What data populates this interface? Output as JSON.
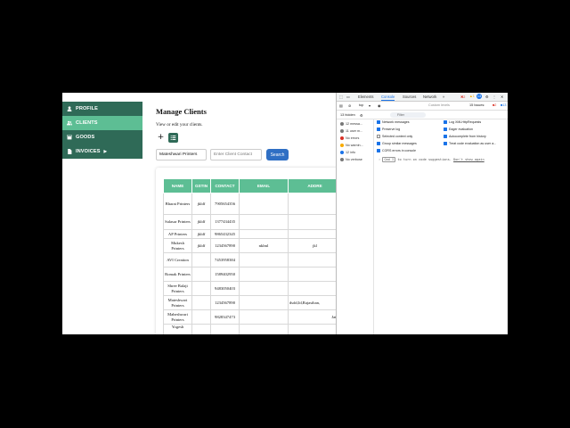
{
  "sidebar": {
    "items": [
      {
        "label": "PROFILE",
        "icon": "user-icon"
      },
      {
        "label": "CLIENTS",
        "icon": "users-icon",
        "active": true
      },
      {
        "label": "GOODS",
        "icon": "box-icon"
      },
      {
        "label": "INVOICES",
        "icon": "file-icon",
        "caret": "▶"
      }
    ]
  },
  "main": {
    "title": "Manage Clients",
    "subtitle": "View or edit your clients.",
    "add_label": "+",
    "search": {
      "client_name_value": "Mateshwari Printers",
      "contact_placeholder": "Enter Client Contact",
      "button_label": "Search"
    },
    "table": {
      "headers": [
        "NAME",
        "GSTIN",
        "CONTACT",
        "EMAIL",
        "ADDRE"
      ],
      "rows": [
        {
          "name": "Bharat Printers",
          "gstin": "jkldf",
          "contact": "7905654356",
          "email": "",
          "address": ""
        },
        {
          "name": "Salasar Printers",
          "gstin": "jkldf",
          "contact": "1377434435",
          "email": "",
          "address": ""
        },
        {
          "name": "AP Printers",
          "gstin": "jkldf",
          "contact": "9865432345",
          "email": "",
          "address": ""
        },
        {
          "name": "Mukesh Printers",
          "gstin": "jkldf",
          "contact": "1234567890",
          "email": "nklml",
          "address": "jkl"
        },
        {
          "name": "AVI Creation",
          "gstin": "",
          "contact": "7453958384",
          "email": "",
          "address": ""
        },
        {
          "name": "Romak Printers",
          "gstin": "",
          "contact": "1589402950",
          "email": "",
          "address": ""
        },
        {
          "name": "Shree Balaji Printers",
          "gstin": "",
          "contact": "9483050403",
          "email": "",
          "address": ""
        },
        {
          "name": "Mateshwari Printers",
          "gstin": "",
          "contact": "1234567890",
          "email": "",
          "address": "dsdd,Id,Rajasthan,"
        },
        {
          "name": "Maheshwari Printers",
          "gstin": "",
          "contact": "9828347473",
          "email": "",
          "address": "Jaipu"
        },
        {
          "name": "Yogesh",
          "gstin": "",
          "contact": "",
          "email": "",
          "address": ""
        }
      ]
    }
  },
  "devtools": {
    "tabs": [
      "Elements",
      "Console",
      "Sources",
      "Network",
      "»"
    ],
    "active_tab": "Console",
    "badges": {
      "errors": "2",
      "warnings": "1",
      "issues_count": "13"
    },
    "toolbar": {
      "context": "top",
      "filter_placeholder": "Filter",
      "levels": "Custom levels",
      "issues": "15 Issues:",
      "hidden": "13 hidden"
    },
    "sidebar": [
      {
        "label": "12 messa...",
        "color": "#555"
      },
      {
        "label": "11 user m...",
        "color": "#555"
      },
      {
        "label": "No errors",
        "color": "#d93025"
      },
      {
        "label": "No warnin...",
        "color": "#f9ab00"
      },
      {
        "label": "12 info",
        "color": "#1a73e8"
      },
      {
        "label": "No verbose",
        "color": "#555"
      }
    ],
    "settings_left": [
      {
        "label": "Network messages",
        "checked": true
      },
      {
        "label": "Preserve log",
        "checked": true
      },
      {
        "label": "Selected context only",
        "checked": false
      },
      {
        "label": "Group similar messages",
        "checked": true
      },
      {
        "label": "CORS errors in console",
        "checked": true
      }
    ],
    "settings_right": [
      {
        "label": "Log XMLHttpRequests",
        "checked": true
      },
      {
        "label": "Eager evaluation",
        "checked": true
      },
      {
        "label": "Autocomplete from history",
        "checked": true
      },
      {
        "label": "Treat code evaluation as user a...",
        "checked": true
      }
    ],
    "console_hint_prefix": "›",
    "console_hint_key": "Cmd I",
    "console_hint_text": " to turn on code suggestions.",
    "console_hint_link": "Don't show again"
  }
}
